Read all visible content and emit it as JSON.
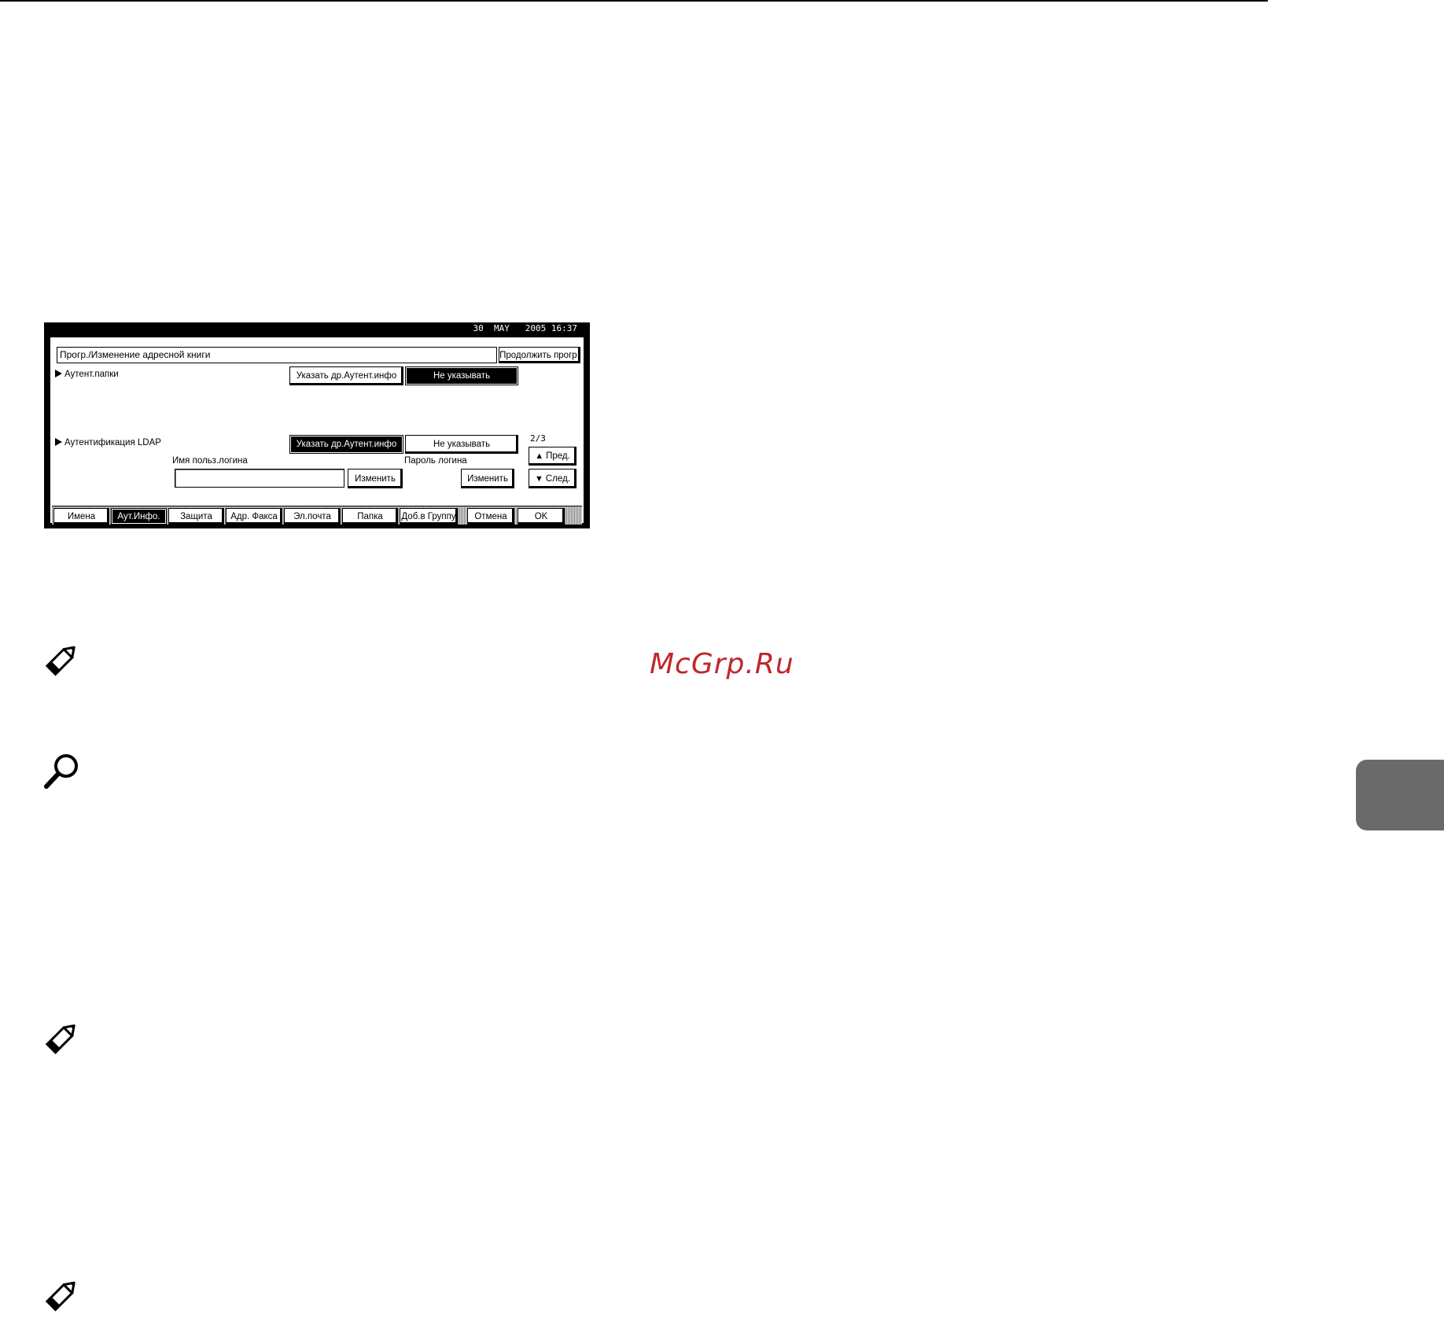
{
  "status_bar": {
    "datetime": "30  MAY   2005 16:37"
  },
  "header": {
    "title": "Прогр./Изменение адресной книги",
    "continue_label": "Продолжить прогр."
  },
  "folder_auth": {
    "label": "Аутент.папки",
    "specify_label": "Указать др.Аутент.инфо",
    "dont_specify_label": "Не указывать",
    "selected": "Не указывать"
  },
  "ldap_auth": {
    "label": "Аутентификация LDAP",
    "specify_label": "Указать др.Аутент.инфо",
    "dont_specify_label": "Не указывать",
    "selected": "Указать др.Аутент.инфо",
    "username_label": "Имя польз.логина",
    "username_value": "",
    "username_change_label": "Изменить",
    "password_label": "Пароль логина",
    "password_change_label": "Изменить"
  },
  "pager": {
    "page_indicator": "2/3",
    "prev_label": "Пред.",
    "next_label": "След."
  },
  "tabs": [
    {
      "label": "Имена"
    },
    {
      "label": "Аут.Инфо.",
      "active": true
    },
    {
      "label": "Защита"
    },
    {
      "label": "Адр. Факса"
    },
    {
      "label": "Эл.почта"
    },
    {
      "label": "Папка"
    },
    {
      "label": "Доб.в Группу"
    }
  ],
  "footer": {
    "cancel_label": "Отмена",
    "ok_label": "OK"
  },
  "page": {
    "watermark": "McGrp.Ru",
    "icons": [
      "note-pencil-icon",
      "reference-magnifier-icon",
      "note-pencil-icon",
      "note-pencil-icon"
    ],
    "side_tab_color": "#6a6a6a",
    "watermark_color": "#c0272d"
  }
}
